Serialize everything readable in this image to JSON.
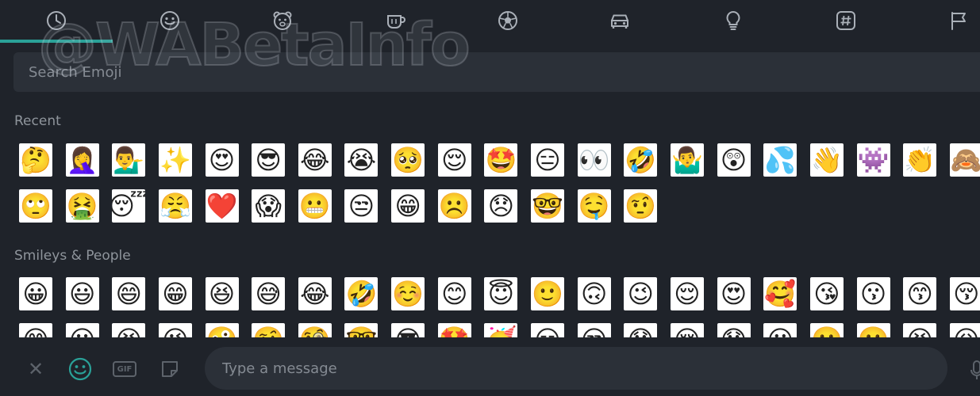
{
  "watermark": "@WABetaInfo",
  "tabs": [
    {
      "name": "recent",
      "icon": "clock-icon"
    },
    {
      "name": "smileys",
      "icon": "smiley-icon"
    },
    {
      "name": "animals",
      "icon": "bear-icon"
    },
    {
      "name": "food",
      "icon": "cup-icon"
    },
    {
      "name": "activity",
      "icon": "soccer-ball-icon"
    },
    {
      "name": "travel",
      "icon": "car-icon"
    },
    {
      "name": "objects",
      "icon": "lightbulb-icon"
    },
    {
      "name": "symbols",
      "icon": "hash-icon"
    },
    {
      "name": "flags",
      "icon": "flag-icon"
    }
  ],
  "accent_color": "#2aa198",
  "search": {
    "placeholder": "Search Emoji"
  },
  "sections": {
    "recent": {
      "title": "Recent",
      "rows": [
        [
          "🤔",
          "🤦‍♀️",
          "💁‍♂️",
          "✨",
          "😍",
          "😎",
          "😂",
          "😭",
          "🥺",
          "😌",
          "🤩",
          "😑",
          "👀",
          "🤣",
          "🤷‍♂️",
          "😲",
          "💦",
          "👋",
          "👾",
          "👏",
          "🙈"
        ],
        [
          "🙄",
          "🤮",
          "😴",
          "😤",
          "❤️",
          "😱",
          "😬",
          "😒",
          "😁",
          "☹️",
          "😞",
          "🤓",
          "🤤",
          "🤨"
        ]
      ]
    },
    "smileys": {
      "title": "Smileys & People",
      "rows": [
        [
          "😀",
          "😃",
          "😄",
          "😁",
          "😆",
          "😅",
          "😂",
          "🤣",
          "☺️",
          "😊",
          "😇",
          "🙂",
          "🙃",
          "😉",
          "😌",
          "😍",
          "🥰",
          "😘",
          "😗",
          "😙",
          "😚"
        ],
        [
          "😋",
          "😛",
          "😝",
          "😜",
          "🤪",
          "🤨",
          "🧐",
          "🤓",
          "😎",
          "🤩",
          "🥳",
          "😏",
          "😒",
          "😞",
          "😔",
          "😟",
          "😕",
          "🙁",
          "☹️",
          "😣",
          "😖"
        ]
      ]
    }
  },
  "composer": {
    "close_label": "✕",
    "gif_label": "GIF",
    "message_placeholder": "Type a message"
  }
}
